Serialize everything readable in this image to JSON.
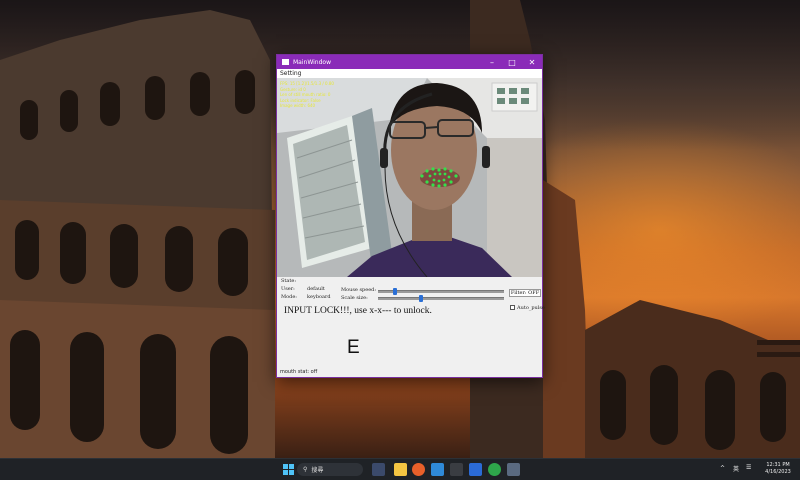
{
  "window": {
    "title": "MainWindow",
    "menu": [
      "Setting"
    ],
    "overlay_lines": [
      "FPS: 15 [1.2]/1.5/1.3 / 0.80",
      "Gesture: id 0",
      "Len of still mouth ratio: 0",
      "Lock indicator: False",
      "Image width: 640"
    ],
    "status": {
      "state_label": "State:",
      "user_label": "User:",
      "user_value": "default",
      "mode_label": "Mode:",
      "mode_value": "keyboard",
      "mouse_speed_label": "Mouse speed:",
      "scale_label": "Scale size:",
      "mouse_speed_value": 0.12,
      "scale_value": 0.34,
      "filter_button": "Filter: OFF",
      "auto_pulse_label": "Auto_pulse",
      "auto_pulse_checked": false,
      "lock_message": "INPUT LOCK!!!, use x-x--- to unlock.",
      "big_letter": "E"
    },
    "statusbar": "mouth stat: off"
  },
  "taskbar": {
    "search_placeholder": "搜尋",
    "lang": "英",
    "time": "12:31 PM",
    "date": "4/16/2023",
    "tray_up_arrow": "^"
  },
  "colors": {
    "titlebar": "#8a2bb8",
    "overlay_text": "#e6e63a",
    "landmarks": "#35e04a",
    "slider_handle": "#2a6fd6"
  }
}
